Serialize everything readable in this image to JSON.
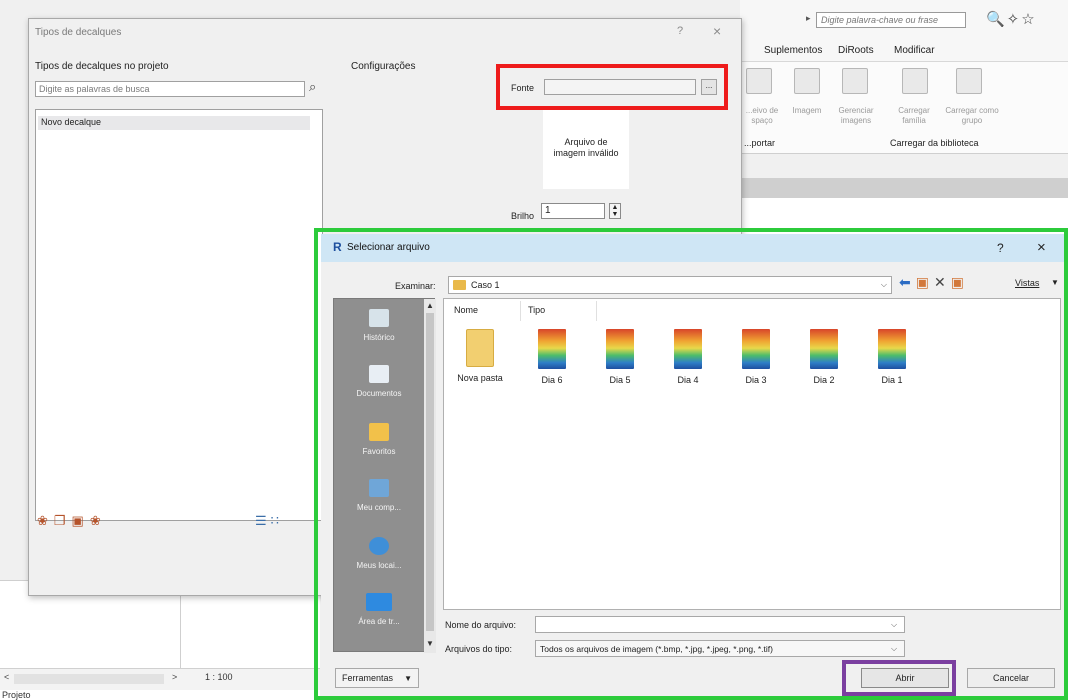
{
  "background": {
    "search_placeholder": "Digite palavra-chave ou frase",
    "ribbon_tabs": [
      "Suplementos",
      "DiRoots",
      "Modificar"
    ],
    "ribbon_items": [
      "...eivo de\nspaço",
      "Imagem",
      "Gerenciar\nimagens",
      "Carregar\nfamília",
      "Carregar como\ngrupo"
    ],
    "group_labels": [
      "...portar",
      "Carregar da biblioteca"
    ],
    "scale": "1 : 100",
    "status_project": "Projeto"
  },
  "decal_dialog": {
    "title": "Tipos de decalques",
    "help": "?",
    "close": "×",
    "types_label": "Tipos de decalques no projeto",
    "search_placeholder": "Digite as palavras de busca",
    "items": [
      "Novo decalque"
    ],
    "settings_label": "Configurações",
    "source_label": "Fonte",
    "source_value": "",
    "browse_label": "...",
    "preview_text": "Arquivo de\nimagem inválido",
    "brightness_label": "Brilho",
    "brightness_value": "1"
  },
  "select_dialog": {
    "app_icon": "R",
    "title": "Selecionar arquivo",
    "help": "?",
    "close": "×",
    "look_in_label": "Examinar:",
    "current_folder": "Caso 1",
    "views_label": "Vistas",
    "places": [
      "Histórico",
      "Documentos",
      "Favoritos",
      "Meu comp...",
      "Meus locai...",
      "Área de tr..."
    ],
    "columns": [
      "Nome",
      "Tipo"
    ],
    "files": [
      {
        "name": "Nova pasta",
        "kind": "folder"
      },
      {
        "name": "Dia 6",
        "kind": "image"
      },
      {
        "name": "Dia 5",
        "kind": "image"
      },
      {
        "name": "Dia 4",
        "kind": "image"
      },
      {
        "name": "Dia 3",
        "kind": "image"
      },
      {
        "name": "Dia 2",
        "kind": "image"
      },
      {
        "name": "Dia 1",
        "kind": "image"
      }
    ],
    "file_name_label": "Nome do arquivo:",
    "file_name_value": "",
    "file_type_label": "Arquivos do tipo:",
    "file_type_value": "Todos os arquivos de imagem (*.bmp, *.jpg, *.jpeg, *.png, *.tif)",
    "tools_label": "Ferramentas",
    "open_label": "Abrir",
    "cancel_label": "Cancelar"
  },
  "highlight_colors": {
    "red": "#ee1b1b",
    "green": "#2ccb3b",
    "purple": "#7b3fa0"
  }
}
